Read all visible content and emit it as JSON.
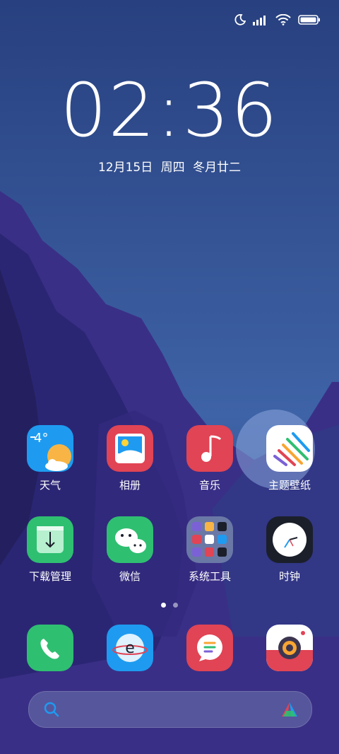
{
  "clock": {
    "time": "02:36",
    "date": "12月15日  周四  冬月廿二"
  },
  "status_icons": [
    "moon-icon",
    "signal-icon",
    "wifi-icon",
    "battery-icon"
  ],
  "row1": [
    {
      "label": "天气",
      "icon": "weather-icon",
      "temp": "4°",
      "color": "#1e9bf0"
    },
    {
      "label": "相册",
      "icon": "gallery-icon",
      "color": "#e14454"
    },
    {
      "label": "音乐",
      "icon": "music-icon",
      "color": "#e14454"
    },
    {
      "label": "主题壁纸",
      "icon": "themes-icon",
      "color": "#ffffff"
    }
  ],
  "row2": [
    {
      "label": "下载管理",
      "icon": "download-icon",
      "color": "#2fbf71"
    },
    {
      "label": "微信",
      "icon": "wechat-icon",
      "color": "#2fbf71"
    },
    {
      "label": "系统工具",
      "icon": "folder-icon",
      "color": "#6a78a6"
    },
    {
      "label": "时钟",
      "icon": "clock-icon",
      "color": "#1b1f2a"
    }
  ],
  "dock": [
    {
      "icon": "phone-icon",
      "color": "#2fbf71"
    },
    {
      "icon": "browser-icon",
      "color": "#1e9bf0"
    },
    {
      "icon": "messages-icon",
      "color": "#e14454"
    },
    {
      "icon": "camera-icon",
      "color": "#ffffff"
    }
  ],
  "pages": {
    "count": 2,
    "active": 0
  },
  "search": {
    "icon": "search-icon",
    "assistant_icon": "assistant-icon"
  }
}
